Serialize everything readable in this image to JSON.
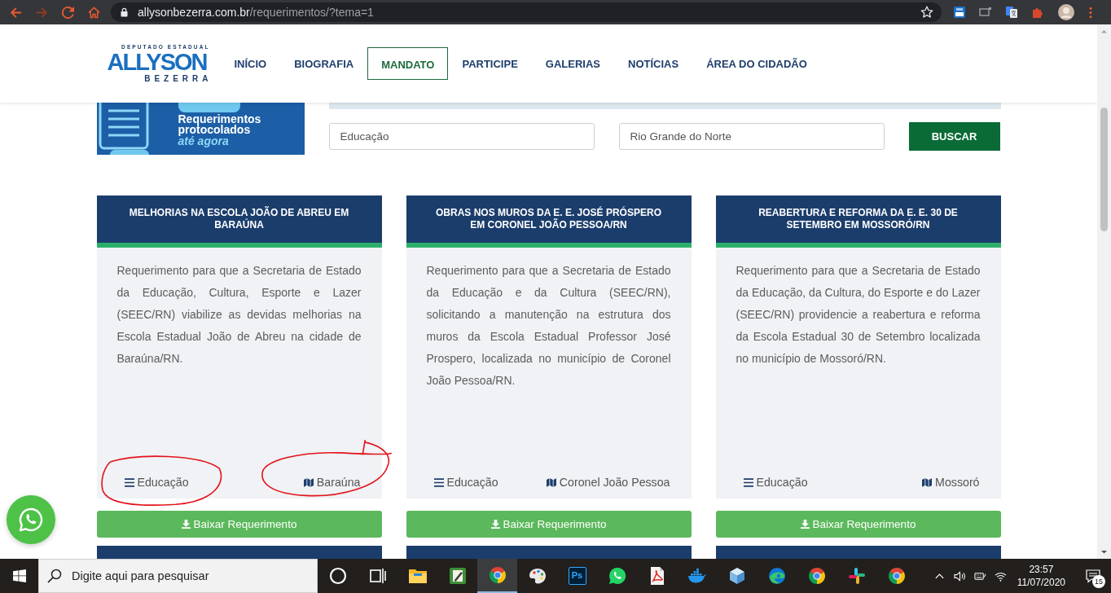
{
  "browser": {
    "url_host": "allysonbezerra.com.br",
    "url_path": "/requerimentos/?tema=1"
  },
  "header": {
    "logo": {
      "top": "DEPUTADO ESTADUAL",
      "name": "ALLYSON",
      "bottom": "BEZERRA"
    },
    "nav": [
      {
        "label": "INÍCIO",
        "selected": false
      },
      {
        "label": "BIOGRAFIA",
        "selected": false
      },
      {
        "label": "MANDATO",
        "selected": true
      },
      {
        "label": "PARTICIPE",
        "selected": false
      },
      {
        "label": "GALERIAS",
        "selected": false
      },
      {
        "label": "NOTÍCIAS",
        "selected": false
      },
      {
        "label": "ÁREA DO CIDADÃO",
        "selected": false
      }
    ]
  },
  "banner": {
    "title": "Requerimentos protocolados",
    "subtitle": "até agora"
  },
  "search": {
    "fields": [
      {
        "value": "Educação"
      },
      {
        "value": "Rio Grande do Norte"
      }
    ],
    "button": "BUSCAR"
  },
  "cards": [
    {
      "kind": "full",
      "title": "MELHORIAS NA ESCOLA JOÃO DE ABREU EM BARAÚNA",
      "text": "Requerimento para que a Secretaria de Estado da Educação, Cultura, Esporte e Lazer (SEEC/RN) viabilize as devidas melhorias na Escola Estadual João de Abreu na cidade de Baraúna/RN.",
      "category": {
        "label": "Educação",
        "circled": true
      },
      "location": {
        "label": "Baraúna",
        "circled": true
      },
      "button": "Baixar Requerimento"
    },
    {
      "kind": "full",
      "title": "OBRAS NOS MUROS DA E. E. JOSÉ PRÓSPERO EM CORONEL JOÃO PESSOA/RN",
      "text": "Requerimento para que a Secretaria de Estado da Educação e da Cultura (SEEC/RN), solicitando a manutenção na estrutura dos muros da Escola Estadual Professor José Prospero, localizada no município de Coronel João Pessoa/RN.",
      "category": {
        "label": "Educação",
        "circled": false
      },
      "location": {
        "label": "Coronel João Pessoa",
        "circled": false
      },
      "button": "Baixar Requerimento"
    },
    {
      "kind": "full",
      "title": "REABERTURA E REFORMA DA E. E. 30 DE SETEMBRO EM MOSSORÓ/RN",
      "text": "Requerimento para que a Secretaria de Estado da Educação, da Cultura, do Esporte e do Lazer (SEEC/RN) providencie a reabertura e reforma da Escola Estadual 30 de Setembro localizada no município de Mossoró/RN.",
      "category": {
        "label": "Educação",
        "circled": false
      },
      "location": {
        "label": "Mossoró",
        "circled": false
      },
      "button": "Baixar Requerimento"
    },
    {
      "kind": "cut_off"
    },
    {
      "kind": "cut_off"
    },
    {
      "kind": "cut_off"
    }
  ],
  "taskbar": {
    "search": {
      "placeholder": "Digite aqui para pesquisar"
    },
    "apps": [
      {
        "kind": "ring",
        "selected": false
      },
      {
        "kind": "taskview",
        "selected": false
      },
      {
        "kind": "folder",
        "selected": false
      },
      {
        "kind": "notes",
        "selected": false
      },
      {
        "kind": "browser",
        "selected": true
      },
      {
        "kind": "palette",
        "selected": false
      },
      {
        "kind": "tile",
        "label": "Ps",
        "selected": false
      },
      {
        "kind": "chat",
        "selected": false
      },
      {
        "kind": "pdf",
        "selected": false
      },
      {
        "kind": "whale",
        "selected": false
      },
      {
        "kind": "cube",
        "selected": false
      },
      {
        "kind": "swirl",
        "selected": false
      },
      {
        "kind": "browser",
        "selected": false
      },
      {
        "kind": "pinwheel",
        "selected": false
      },
      {
        "kind": "browser",
        "selected": false
      }
    ],
    "time": "23:57",
    "date": "11/07/2020",
    "notifications": "15"
  }
}
